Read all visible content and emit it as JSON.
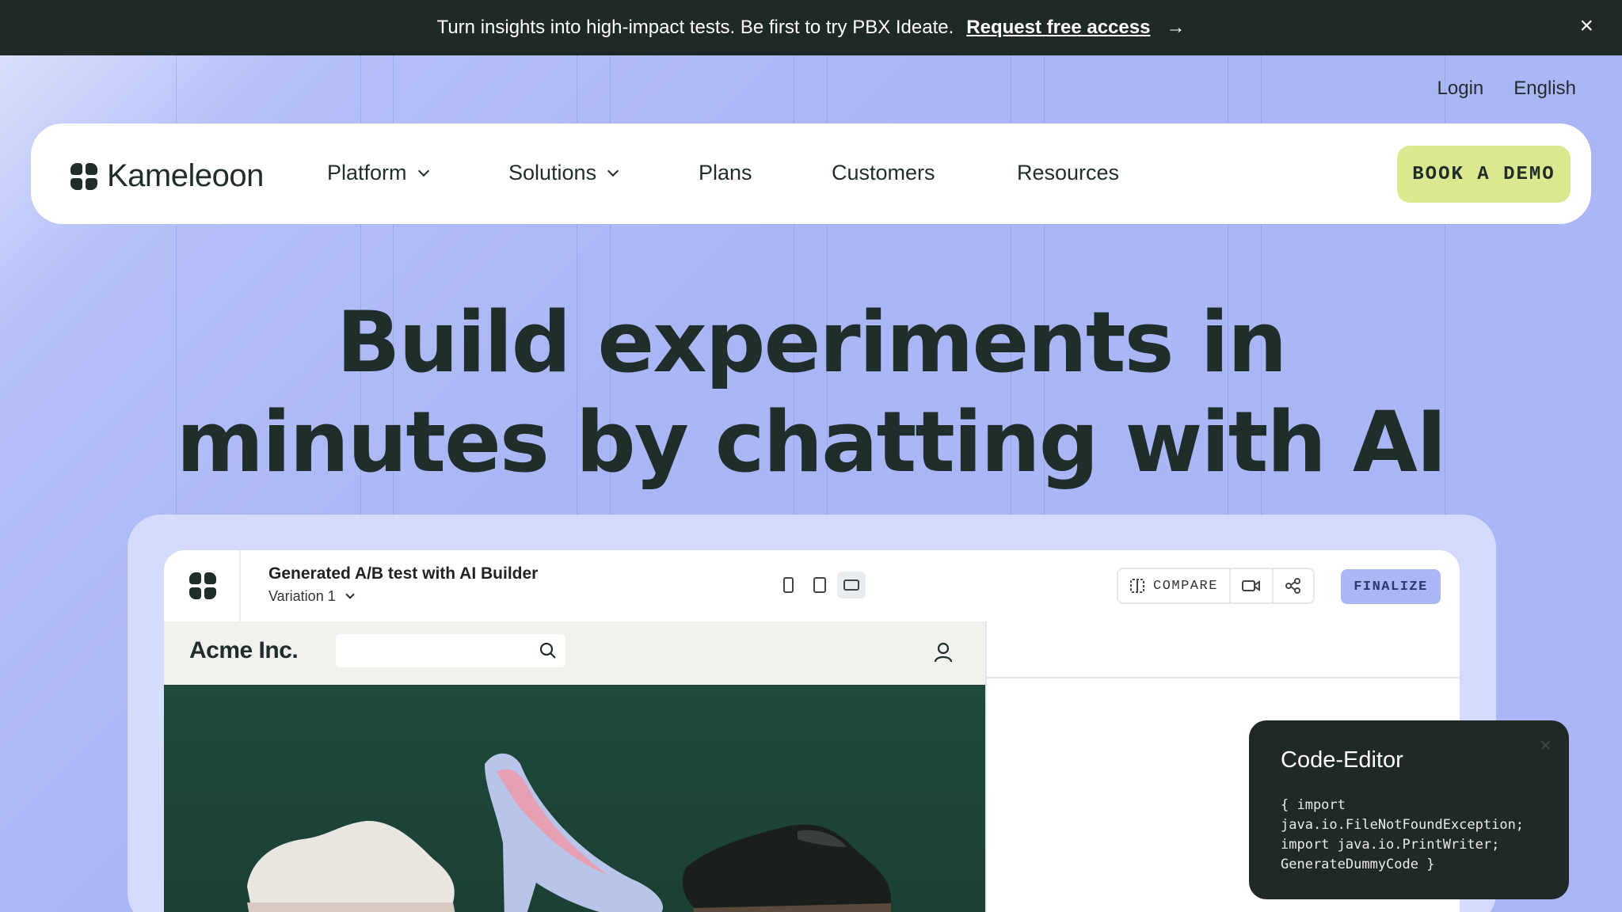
{
  "announcement": {
    "text": "Turn insights into high-impact tests. Be first to try PBX Ideate.",
    "link_label": "Request free access",
    "arrow": "→",
    "close": "×"
  },
  "utility_nav": {
    "login": "Login",
    "language": "English"
  },
  "nav": {
    "brand": "Kameleoon",
    "items": [
      {
        "label": "Platform",
        "has_dropdown": true
      },
      {
        "label": "Solutions",
        "has_dropdown": true
      },
      {
        "label": "Plans",
        "has_dropdown": false
      },
      {
        "label": "Customers",
        "has_dropdown": false
      },
      {
        "label": "Resources",
        "has_dropdown": false
      }
    ],
    "cta_label": "BOOK A DEMO"
  },
  "hero": {
    "headline_line1": "Build experiments in",
    "headline_line2": "minutes by chatting with AI"
  },
  "app": {
    "title": "Generated A/B test with AI Builder",
    "variation": "Variation 1",
    "devices": [
      "mobile-icon",
      "tablet-icon",
      "desktop-icon"
    ],
    "active_device": "desktop",
    "compare_label": "COMPARE",
    "finalize_label": "FINALIZE",
    "shop_brand": "Acme Inc."
  },
  "code_editor": {
    "title": "Code-Editor",
    "close": "×",
    "code": "{ import\njava.io.FileNotFoundException;\nimport java.io.PrintWriter;\nGenerateDummyCode }"
  },
  "colors": {
    "announcement_bg": "#1f2a27",
    "hero_bg": "#aab6f5",
    "cta_bg": "#dbe88f",
    "ink": "#1f2d2b",
    "finalize_bg": "#aab6f5"
  }
}
